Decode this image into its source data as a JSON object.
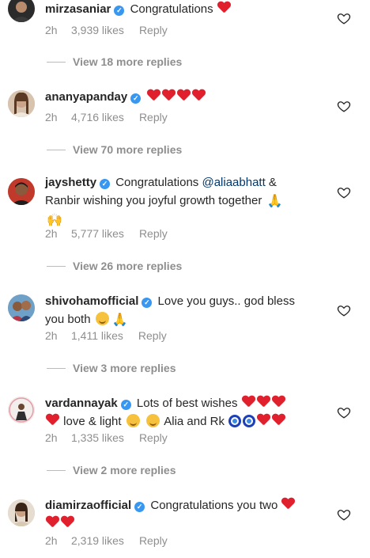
{
  "comments": [
    {
      "username": "mirzasaniar",
      "text": "Congratulations",
      "time": "2h",
      "likes": "3,939 likes",
      "reply": "Reply",
      "more_replies": "View 18 more replies"
    },
    {
      "username": "ananyapanday",
      "time": "2h",
      "likes": "4,716 likes",
      "reply": "Reply",
      "more_replies": "View 70 more replies"
    },
    {
      "username": "jayshetty",
      "text_part1": "Congratulations",
      "mention": "@aliaabhatt",
      "text_part2": "& Ranbir wishing you joyful growth together",
      "time": "2h",
      "likes": "5,777 likes",
      "reply": "Reply",
      "more_replies": "View 26 more replies"
    },
    {
      "username": "shivohamofficial",
      "text": "Love you guys.. god bless you both",
      "time": "2h",
      "likes": "1,411 likes",
      "reply": "Reply",
      "more_replies": "View 3 more replies"
    },
    {
      "username": "vardannayak",
      "text_part1": "Lots of best wishes",
      "text_part2": "love & light",
      "text_part3": "Alia and Rk",
      "time": "2h",
      "likes": "1,335 likes",
      "reply": "Reply",
      "more_replies": "View 2 more replies"
    },
    {
      "username": "diamirzaofficial",
      "text": "Congratulations you two",
      "time": "2h",
      "likes": "2,319 likes",
      "reply": "Reply"
    }
  ],
  "icons": {
    "verified": "verified-badge-icon",
    "like": "heart-outline-icon"
  },
  "colors": {
    "verified": "#3897f0",
    "heart": "#e0202d",
    "mention": "#00376b",
    "muted": "#8e8e8e"
  }
}
